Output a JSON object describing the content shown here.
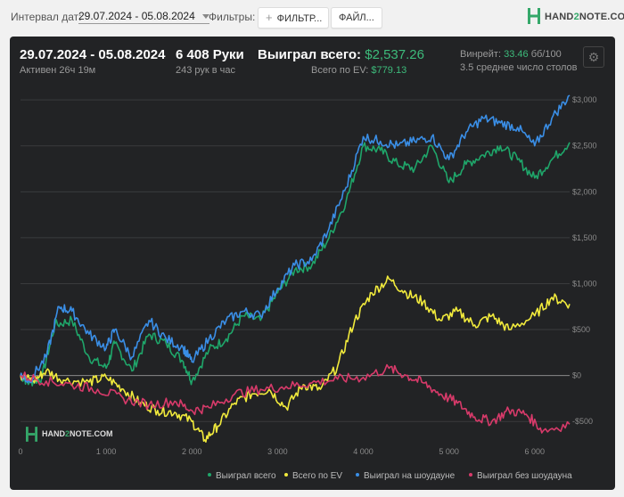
{
  "toolbar": {
    "interval_label": "Интервал дат:",
    "date_range": "29.07.2024 - 05.08.2024",
    "filters_label": "Фильтры:",
    "filter_button": "ФИЛЬТР...",
    "file_button": "ФАЙЛ..."
  },
  "logo": {
    "hand": "HAND",
    "two": "2",
    "note": "NOTE.COM"
  },
  "summary": {
    "range": "29.07.2024 - 05.08.2024",
    "active": "Активен 26ч 19м",
    "hands": "6 408 Руки",
    "hands_rate": "243 рук в час",
    "won_label": "Выиграл всего:",
    "won_value": "$2,537.26",
    "ev_label": "Всего по EV:",
    "ev_value": "$779.13",
    "winrate_label": "Винрейт:",
    "winrate_value": "33.46",
    "winrate_suffix": "бб/100",
    "tables": "3.5 среднее число столов"
  },
  "colors": {
    "total": "#1fa66a",
    "ev": "#f1ea3c",
    "showdown": "#3a8ee6",
    "non_showdown": "#d83a6a",
    "background": "#222325"
  },
  "chart_data": {
    "type": "line",
    "xlim": [
      0,
      6408
    ],
    "ylim": [
      -750,
      3050
    ],
    "x_ticks": [
      0,
      1000,
      2000,
      3000,
      4000,
      5000,
      6000
    ],
    "x_tick_labels": [
      "0",
      "1 000",
      "2 000",
      "3 000",
      "4 000",
      "5 000",
      "6 000"
    ],
    "y_ticks": [
      -500,
      0,
      500,
      1000,
      1500,
      2000,
      2500,
      3000
    ],
    "y_tick_labels": [
      "-$500",
      "$0",
      "$500",
      "$1,000",
      "$1,500",
      "$2,000",
      "$2,500",
      "$3,000"
    ],
    "series": [
      {
        "name": "Выиграл всего",
        "color": "#1fa66a",
        "points": [
          [
            0,
            0
          ],
          [
            100,
            -80
          ],
          [
            250,
            -20
          ],
          [
            400,
            550
          ],
          [
            600,
            600
          ],
          [
            800,
            200
          ],
          [
            1000,
            80
          ],
          [
            1100,
            350
          ],
          [
            1300,
            50
          ],
          [
            1500,
            450
          ],
          [
            1700,
            350
          ],
          [
            1900,
            150
          ],
          [
            2000,
            -60
          ],
          [
            2200,
            280
          ],
          [
            2400,
            400
          ],
          [
            2600,
            650
          ],
          [
            2800,
            600
          ],
          [
            3000,
            900
          ],
          [
            3200,
            1150
          ],
          [
            3400,
            1200
          ],
          [
            3600,
            1500
          ],
          [
            3800,
            1900
          ],
          [
            4000,
            2500
          ],
          [
            4200,
            2450
          ],
          [
            4400,
            2300
          ],
          [
            4600,
            2250
          ],
          [
            4800,
            2500
          ],
          [
            5000,
            2100
          ],
          [
            5200,
            2300
          ],
          [
            5400,
            2400
          ],
          [
            5600,
            2500
          ],
          [
            5800,
            2350
          ],
          [
            6000,
            2150
          ],
          [
            6200,
            2350
          ],
          [
            6408,
            2537
          ]
        ]
      },
      {
        "name": "Всего по EV",
        "color": "#f1ea3c",
        "points": [
          [
            0,
            0
          ],
          [
            150,
            -60
          ],
          [
            300,
            50
          ],
          [
            500,
            -50
          ],
          [
            800,
            -70
          ],
          [
            1000,
            -20
          ],
          [
            1200,
            -150
          ],
          [
            1400,
            -300
          ],
          [
            1600,
            -380
          ],
          [
            1800,
            -400
          ],
          [
            2000,
            -500
          ],
          [
            2150,
            -700
          ],
          [
            2300,
            -550
          ],
          [
            2500,
            -300
          ],
          [
            2700,
            -200
          ],
          [
            2900,
            -150
          ],
          [
            3100,
            -350
          ],
          [
            3300,
            -100
          ],
          [
            3500,
            -150
          ],
          [
            3700,
            100
          ],
          [
            3900,
            600
          ],
          [
            4100,
            900
          ],
          [
            4300,
            1050
          ],
          [
            4500,
            900
          ],
          [
            4700,
            800
          ],
          [
            4900,
            600
          ],
          [
            5100,
            700
          ],
          [
            5300,
            550
          ],
          [
            5500,
            650
          ],
          [
            5700,
            500
          ],
          [
            6000,
            650
          ],
          [
            6200,
            850
          ],
          [
            6408,
            779
          ]
        ]
      },
      {
        "name": "Выиграл на шоудауне",
        "color": "#3a8ee6",
        "points": [
          [
            0,
            0
          ],
          [
            100,
            -60
          ],
          [
            300,
            200
          ],
          [
            450,
            750
          ],
          [
            600,
            700
          ],
          [
            800,
            450
          ],
          [
            1000,
            300
          ],
          [
            1100,
            500
          ],
          [
            1300,
            200
          ],
          [
            1500,
            600
          ],
          [
            1700,
            400
          ],
          [
            1900,
            300
          ],
          [
            2000,
            150
          ],
          [
            2200,
            400
          ],
          [
            2400,
            600
          ],
          [
            2600,
            700
          ],
          [
            2800,
            650
          ],
          [
            3000,
            950
          ],
          [
            3200,
            1200
          ],
          [
            3400,
            1250
          ],
          [
            3600,
            1600
          ],
          [
            3800,
            2050
          ],
          [
            4000,
            2600
          ],
          [
            4200,
            2550
          ],
          [
            4400,
            2500
          ],
          [
            4600,
            2550
          ],
          [
            4800,
            2600
          ],
          [
            5000,
            2350
          ],
          [
            5200,
            2650
          ],
          [
            5400,
            2800
          ],
          [
            5600,
            2750
          ],
          [
            5800,
            2700
          ],
          [
            6000,
            2500
          ],
          [
            6200,
            2800
          ],
          [
            6408,
            3050
          ]
        ]
      },
      {
        "name": "Выиграл без шоудауна",
        "color": "#d83a6a",
        "points": [
          [
            0,
            0
          ],
          [
            300,
            -60
          ],
          [
            600,
            -100
          ],
          [
            900,
            -150
          ],
          [
            1200,
            -250
          ],
          [
            1500,
            -320
          ],
          [
            1800,
            -280
          ],
          [
            2000,
            -380
          ],
          [
            2200,
            -350
          ],
          [
            2500,
            -200
          ],
          [
            2800,
            -150
          ],
          [
            3100,
            -120
          ],
          [
            3400,
            -80
          ],
          [
            3700,
            -40
          ],
          [
            4000,
            -20
          ],
          [
            4300,
            80
          ],
          [
            4500,
            0
          ],
          [
            4700,
            -80
          ],
          [
            4900,
            -200
          ],
          [
            5100,
            -300
          ],
          [
            5300,
            -450
          ],
          [
            5500,
            -500
          ],
          [
            5700,
            -380
          ],
          [
            5900,
            -420
          ],
          [
            6100,
            -600
          ],
          [
            6408,
            -530
          ]
        ]
      }
    ]
  }
}
